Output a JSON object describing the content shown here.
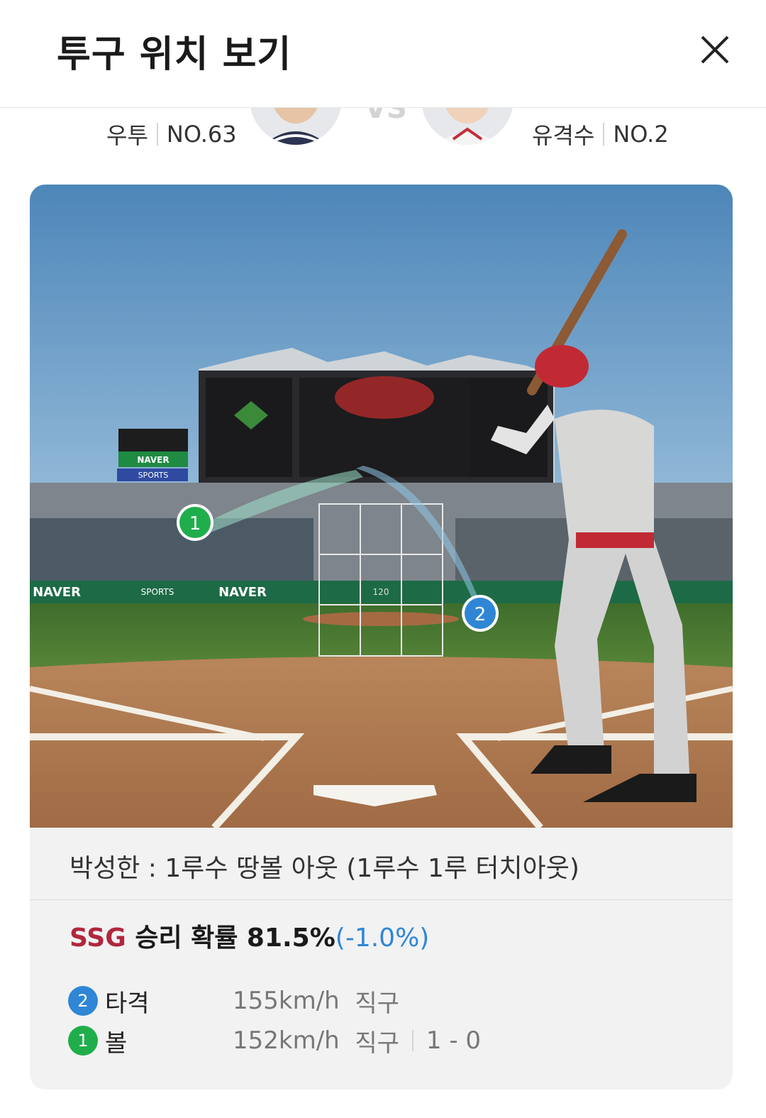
{
  "header": {
    "title": "투구 위치 보기"
  },
  "pitcher": {
    "name": "우투",
    "number": "NO.63"
  },
  "batter": {
    "name": "유격수",
    "number": "NO.2"
  },
  "scene": {
    "ads": [
      "NAVER",
      "SPORTS"
    ],
    "count_label": "120",
    "pitch_markers": [
      {
        "num": "1",
        "color": "#1fae4b"
      },
      {
        "num": "2",
        "color": "#2f86d5"
      }
    ]
  },
  "result": {
    "text": "박성한 : 1루수 땅볼 아웃 (1루수 1루 터치아웃)"
  },
  "win_probability": {
    "team": "SSG",
    "label": "승리 확률 81.5%",
    "delta": "(-1.0%)"
  },
  "pitches": [
    {
      "num": "2",
      "type_label": "타격",
      "speed": "155km/h",
      "pitch_type": "직구",
      "count": "",
      "color": "#2f86d5"
    },
    {
      "num": "1",
      "type_label": "볼",
      "speed": "152km/h",
      "pitch_type": "직구",
      "count": "1 - 0",
      "color": "#1fae4b"
    }
  ],
  "colors": {
    "team_accent": "#b0273d",
    "delta": "#2f86d5"
  }
}
